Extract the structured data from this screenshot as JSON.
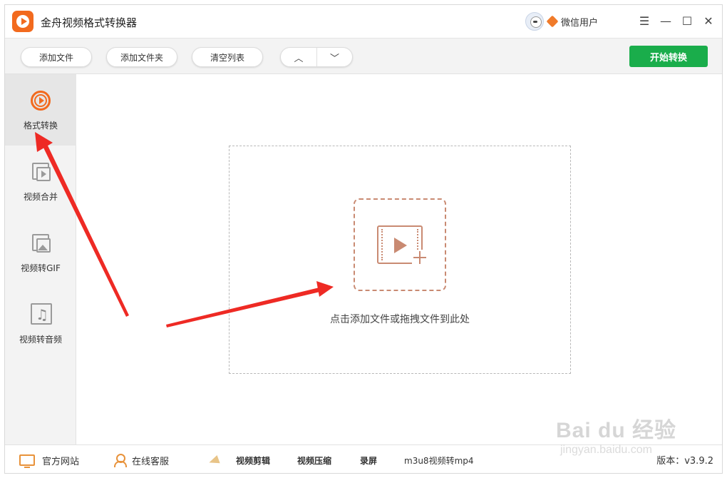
{
  "app": {
    "title": "金舟视频格式转换器",
    "user_name": "微信用户",
    "controls": {
      "menu": "☰",
      "minimize": "—",
      "maximize": "☐",
      "close": "✕"
    }
  },
  "toolbar": {
    "add_file": "添加文件",
    "add_folder": "添加文件夹",
    "clear_list": "清空列表",
    "move_up": "︿",
    "move_down": "﹀",
    "start_convert": "开始转换"
  },
  "sidebar": {
    "items": [
      {
        "label": "格式转换",
        "icon": "format-convert-icon",
        "active": true
      },
      {
        "label": "视频合并",
        "icon": "video-merge-icon",
        "active": false
      },
      {
        "label": "视频转GIF",
        "icon": "video-to-gif-icon",
        "active": false
      },
      {
        "label": "视频转音频",
        "icon": "video-to-audio-icon",
        "active": false
      }
    ]
  },
  "main": {
    "drop_hint": "点击添加文件或拖拽文件到此处"
  },
  "footer": {
    "official_site": "官方网站",
    "online_service": "在线客服",
    "tools": [
      "视频剪辑",
      "视频压缩",
      "录屏",
      "m3u8视频转mp4"
    ],
    "version": "版本：v3.9.2"
  },
  "watermark": {
    "logo": "Bai du 经验",
    "url": "jingyan.baidu.com"
  },
  "colors": {
    "accent": "#f26a1e",
    "start_button": "#1aad4b",
    "annotation_arrow": "#ee2a24",
    "upload_icon": "#c98a72"
  }
}
